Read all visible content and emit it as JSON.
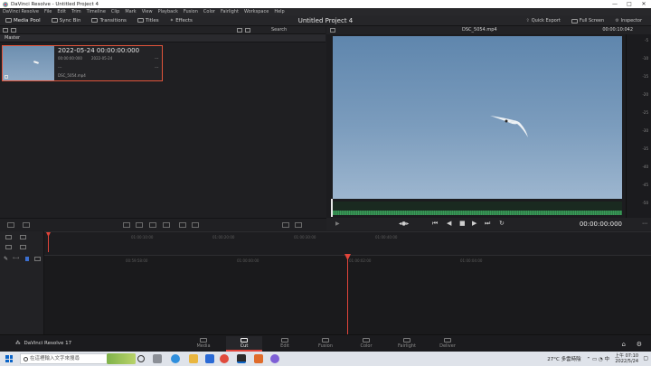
{
  "window": {
    "title": "DaVinci Resolve - Untitled Project 4",
    "controls": [
      "—",
      "□",
      "✕"
    ]
  },
  "menu": [
    "DaVinci Resolve",
    "File",
    "Edit",
    "Trim",
    "Timeline",
    "Clip",
    "Mark",
    "View",
    "Playback",
    "Fusion",
    "Color",
    "Fairlight",
    "Workspace",
    "Help"
  ],
  "toolbar": {
    "media_pool": "Media Pool",
    "sync_bin": "Sync Bin",
    "transitions": "Transitions",
    "titles": "Titles",
    "effects": "Effects",
    "project_title": "Untitled Project 4",
    "quick_export": "Quick Export",
    "full_screen": "Full Screen",
    "inspector": "Inspector"
  },
  "media_pool": {
    "search_label": "Search",
    "bin": "Master",
    "clip": {
      "title": "2022-05-24  00:00:00:000",
      "in_tc": "00:00:00:000",
      "date": "2022-05-24",
      "dash": "---",
      "filename": "DSC_5054.mp4"
    }
  },
  "viewer": {
    "filename": "DSC_5054.mp4",
    "timecode": "00:00:10:042",
    "scope_scale": [
      "-5",
      "-10",
      "-15",
      "-20",
      "-25",
      "-30",
      "-35",
      "-40",
      "-45",
      "-50"
    ]
  },
  "transport": {
    "timecode": "00:00:00:000"
  },
  "timeline": {
    "ruler_top": [
      "01:00:00:00",
      "01:00:10:00",
      "01:00:20:00",
      "01:00:30:00",
      "01:00:40:00"
    ],
    "ruler_main": [
      "00:59:58:00",
      "01:00:00:00",
      "01:00:02:00",
      "01:00:04:00"
    ]
  },
  "pages": [
    {
      "label": "Media",
      "active": false
    },
    {
      "label": "Cut",
      "active": true
    },
    {
      "label": "Edit",
      "active": false
    },
    {
      "label": "Fusion",
      "active": false
    },
    {
      "label": "Color",
      "active": false
    },
    {
      "label": "Fairlight",
      "active": false
    },
    {
      "label": "Deliver",
      "active": false
    }
  ],
  "brand": "DaVinci Resolve 17",
  "taskbar": {
    "search_placeholder": "在這裡輸入文字來搜尋",
    "weather": "27°C  多雲時陰",
    "time": "上午 07:10",
    "date": "2022/5/24"
  },
  "colors": {
    "accent_red": "#e0443a",
    "panel_bg": "#1e1e21",
    "audio_green": "#3b9a59"
  }
}
